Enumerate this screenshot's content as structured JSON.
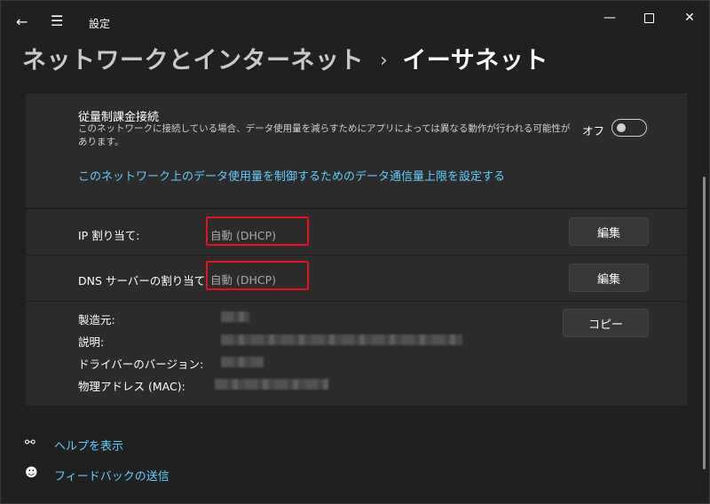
{
  "titlebar": {
    "app_title": "設定",
    "back_icon": "back-arrow-icon",
    "menu_icon": "hamburger-menu-icon"
  },
  "breadcrumb": {
    "parent": "ネットワークとインターネット",
    "separator": "›",
    "current": "イーサネット"
  },
  "metered": {
    "title": "従量制課金接続",
    "description": "このネットワークに接続している場合、データ使用量を減らすためにアプリによっては異なる動作が行われる可能性があります。",
    "toggle_label": "オフ",
    "toggle_state": "off",
    "limit_link": "このネットワーク上のデータ使用量を制御するためのデータ通信量上限を設定する"
  },
  "ip": {
    "label": "IP 割り当て:",
    "value": "自動 (DHCP)",
    "edit_label": "編集"
  },
  "dns": {
    "label": "DNS サーバーの割り当て:",
    "value": "自動 (DHCP)",
    "edit_label": "編集"
  },
  "properties": {
    "manufacturer_label": "製造元:",
    "description_label": "説明:",
    "driver_label": "ドライバーのバージョン:",
    "mac_label": "物理アドレス (MAC):",
    "copy_label": "コピー"
  },
  "footer": {
    "help_label": "ヘルプを表示",
    "feedback_label": "フィードバックの送信"
  },
  "colors": {
    "accent_link": "#60cdff",
    "highlight_border": "#e8101e",
    "background": "#202020",
    "card": "#2b2b2b"
  }
}
